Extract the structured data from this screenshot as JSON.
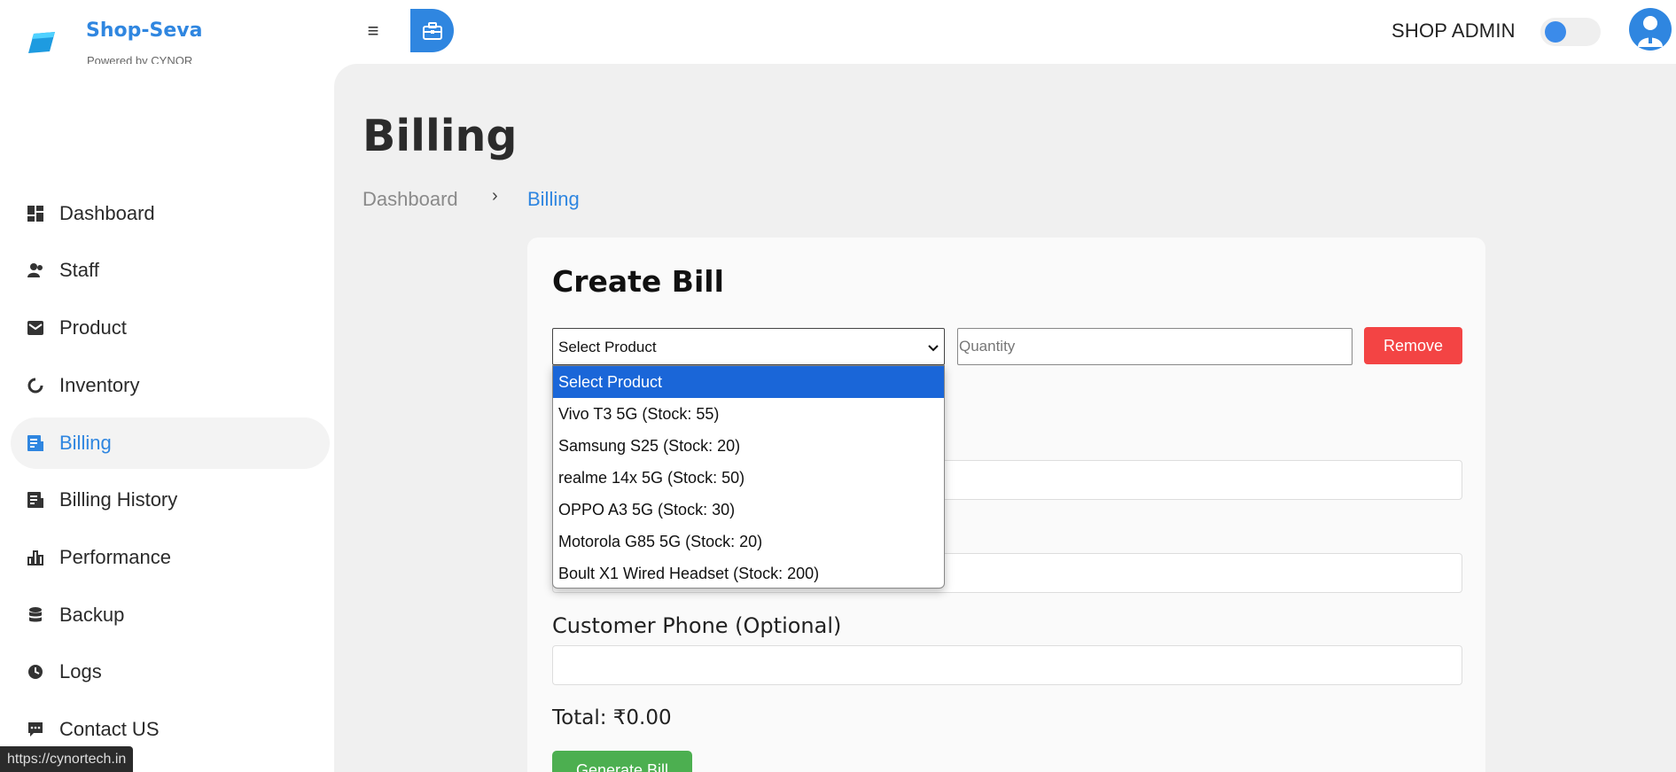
{
  "app": {
    "brand": "Shop-Seva",
    "brand_sub": "Powered by CYNOR"
  },
  "header": {
    "admin_label": "SHOP ADMIN",
    "theme_toggle_on": true,
    "icons": [
      "menu-icon",
      "briefcase-icon",
      "user-avatar-icon"
    ]
  },
  "sidebar": {
    "items": [
      {
        "label": "Dashboard",
        "icon": "dashboard-icon"
      },
      {
        "label": "Staff",
        "icon": "staff-icon"
      },
      {
        "label": "Product",
        "icon": "product-icon"
      },
      {
        "label": "Inventory",
        "icon": "inventory-icon"
      },
      {
        "label": "Billing",
        "icon": "billing-icon",
        "active": true
      },
      {
        "label": "Billing History",
        "icon": "billing-history-icon"
      },
      {
        "label": "Performance",
        "icon": "performance-icon"
      },
      {
        "label": "Backup",
        "icon": "backup-icon"
      },
      {
        "label": "Logs",
        "icon": "logs-icon"
      },
      {
        "label": "Contact US",
        "icon": "contact-icon"
      }
    ]
  },
  "page": {
    "title": "Billing",
    "breadcrumb": {
      "parent": "Dashboard",
      "separator": "›",
      "current": "Billing"
    }
  },
  "bill": {
    "title": "Create Bill",
    "product_select": {
      "selected": "Select Product",
      "options": [
        "Select Product",
        "Vivo T3 5G (Stock: 55)",
        "Samsung S25 (Stock: 20)",
        "realme 14x 5G (Stock: 50)",
        "OPPO A3 5G (Stock: 30)",
        "Motorola G85 5G (Stock: 20)",
        "Boult X1 Wired Headset (Stock: 200)"
      ]
    },
    "quantity_placeholder": "Quantity",
    "remove_label": "Remove",
    "customer_phone_label": "Customer Phone (Optional)",
    "total": "Total: ₹0.00",
    "generate_label": "Generate Bill"
  },
  "status_url": "https://cynortech.in",
  "colors": {
    "accent": "#2f86e0",
    "danger": "#f34444",
    "success": "#4caf50",
    "dropdown_highlight": "#1a66d8"
  }
}
